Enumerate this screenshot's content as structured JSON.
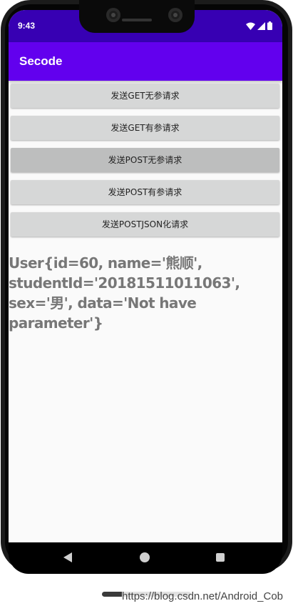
{
  "status_bar": {
    "time": "9:43",
    "background_color": "#3700b3",
    "icons": [
      "wifi-icon",
      "signal-icon",
      "battery-icon"
    ]
  },
  "app_bar": {
    "title": "Secode",
    "background_color": "#6200ee"
  },
  "buttons": [
    {
      "label": "发送GET无参请求"
    },
    {
      "label": "发送GET有参请求"
    },
    {
      "label": "发送POST无参请求"
    },
    {
      "label": "发送POST有参请求"
    },
    {
      "label": "发送POSTJSON化请求"
    }
  ],
  "result_text": "User{id=60, name='熊顺',\nstudentId='20181511011063',\nsex='男', data='Not have parameter'}",
  "nav_bar": {
    "icons": [
      "back-icon",
      "home-icon",
      "recents-icon"
    ]
  },
  "watermark": "https://blog.csdn.net/Android_Cob"
}
